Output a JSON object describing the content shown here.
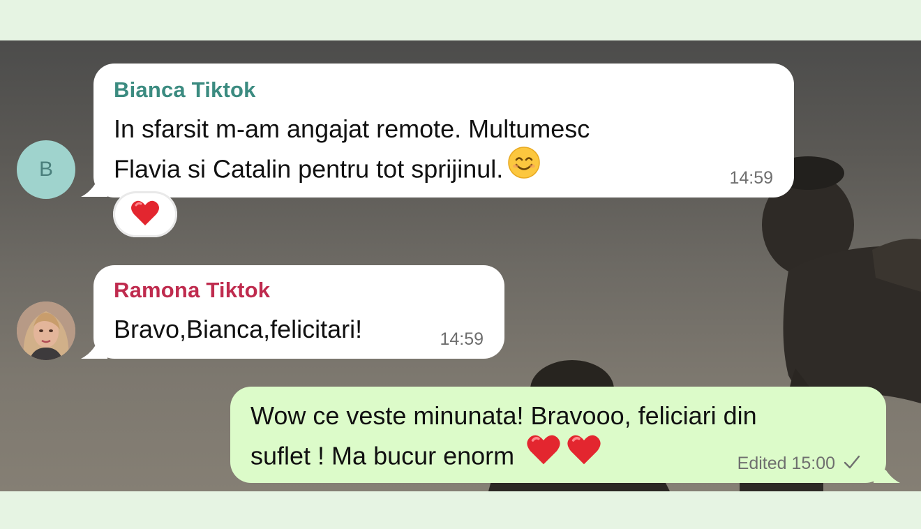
{
  "messages": [
    {
      "sender": "Bianca Tiktok",
      "sender_color": "#3b8b80",
      "avatar_initial": "B",
      "lines": [
        "In sfarsit m-am angajat remote. Multumesc",
        "Flavia si Catalin pentru tot sprijinul."
      ],
      "inline_emoji": "smiling-face-emoji",
      "time": "14:59",
      "reaction": "red-heart-emoji"
    },
    {
      "sender": "Ramona Tiktok",
      "sender_color": "#bf2b4e",
      "avatar": "profile-photo",
      "lines": [
        "Bravo,Bianca,felicitari!"
      ],
      "time": "14:59"
    },
    {
      "outgoing": true,
      "lines": [
        "Wow ce veste minunata! Bravooo, feliciari din",
        "suflet ! Ma bucur enorm"
      ],
      "inline_emojis": [
        "red-heart-emoji",
        "red-heart-emoji"
      ],
      "status": "Edited 15:00",
      "status_icon": "check-icon"
    }
  ],
  "colors": {
    "incoming_bubble": "#ffffff",
    "outgoing_bubble": "#dcfbc9",
    "app_background": "#e6f4e3"
  }
}
